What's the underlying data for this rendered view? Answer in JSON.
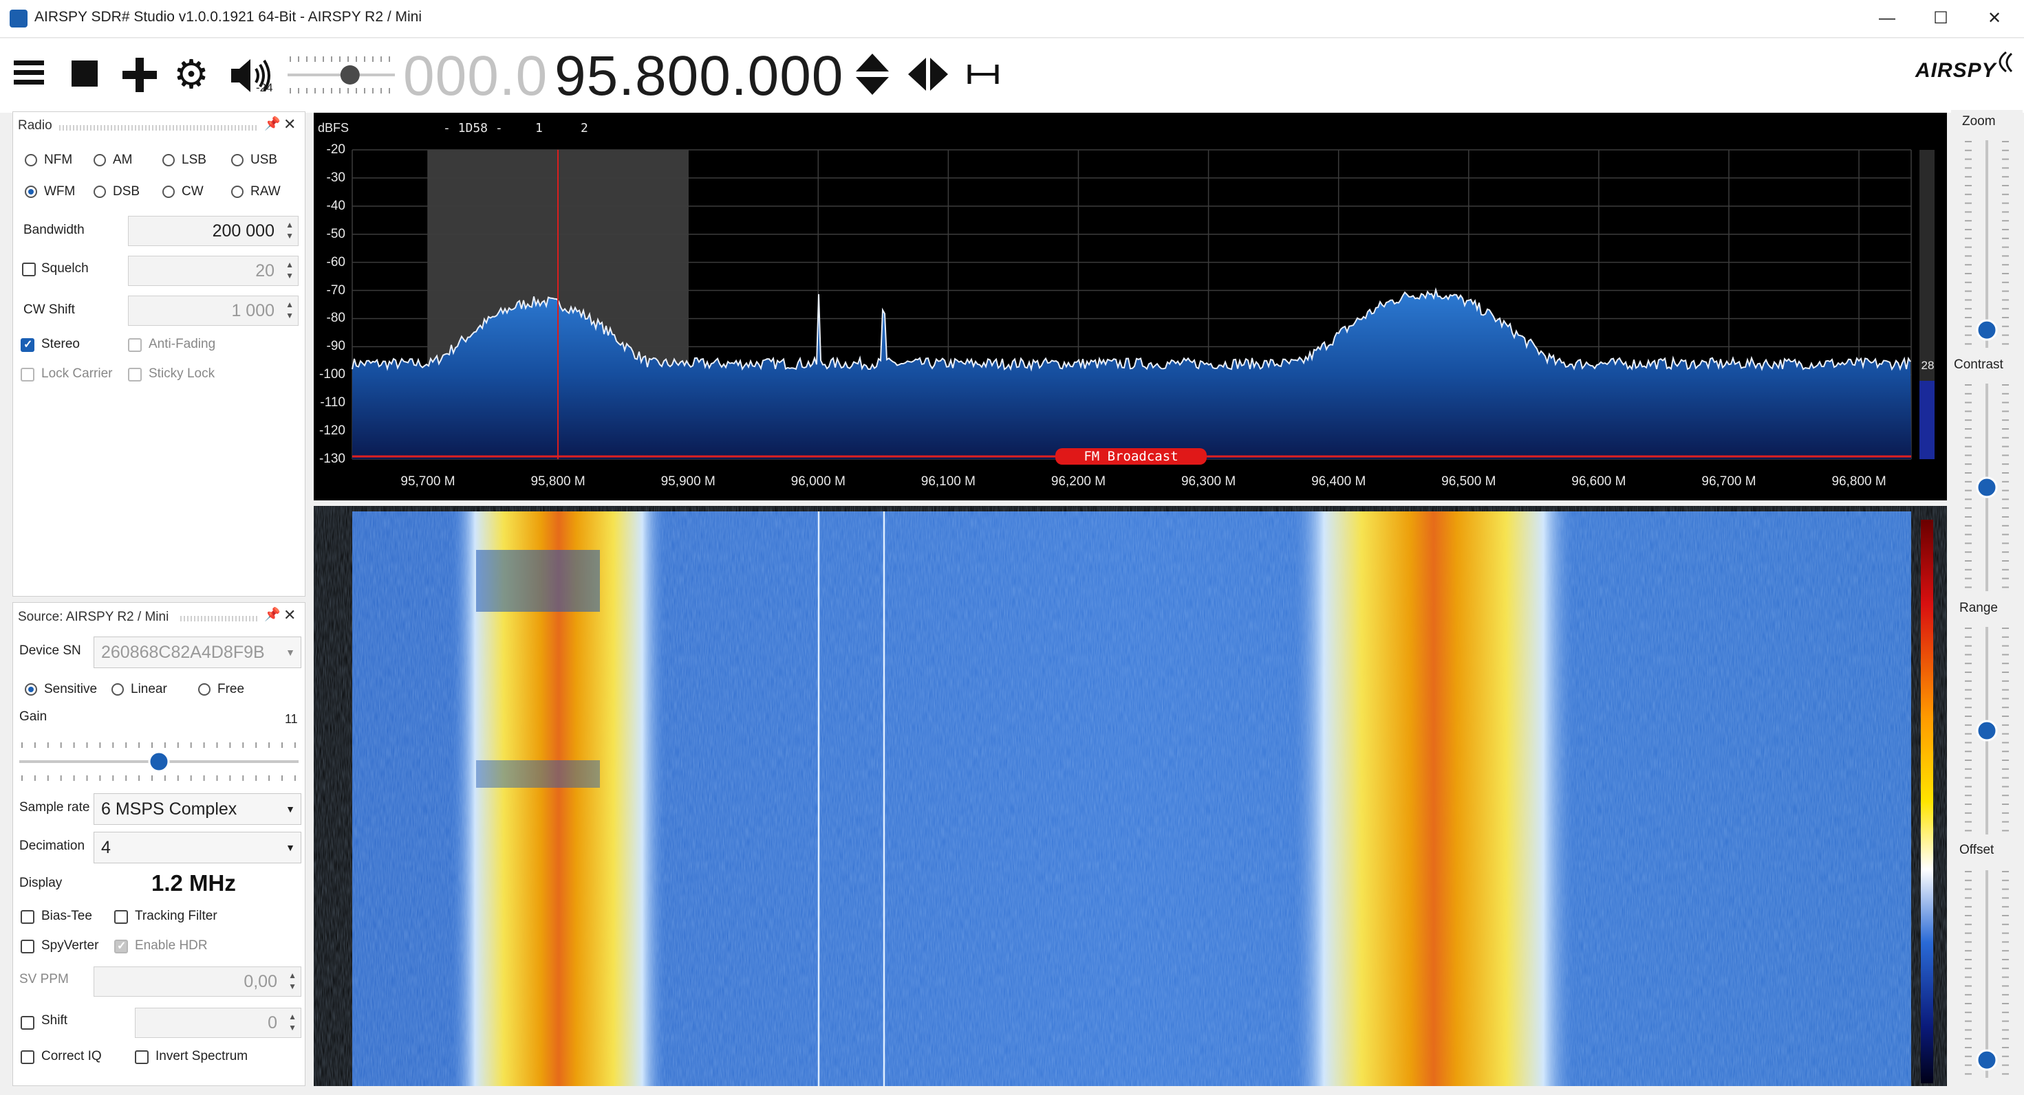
{
  "window": {
    "title": "AIRSPY SDR# Studio v1.0.0.1921 64-Bit - AIRSPY R2 / Mini",
    "controls": {
      "minimize": "—",
      "maximize": "☐",
      "close": "✕"
    }
  },
  "toolbar": {
    "menu_icon": "hamburger-icon",
    "stop_icon": "stop-icon",
    "add_icon": "plus-icon",
    "settings_icon": "gear-icon",
    "volume_icon": "speaker-icon",
    "volume_value": "-24",
    "volume_level": 0.6,
    "frequency_dim": "000.0",
    "frequency_main": "95.800.000",
    "logo": "AIRSPY"
  },
  "radio_panel": {
    "title": "Radio",
    "modes": [
      {
        "label": "NFM",
        "selected": false
      },
      {
        "label": "AM",
        "selected": false
      },
      {
        "label": "LSB",
        "selected": false
      },
      {
        "label": "USB",
        "selected": false
      },
      {
        "label": "WFM",
        "selected": true
      },
      {
        "label": "DSB",
        "selected": false
      },
      {
        "label": "CW",
        "selected": false
      },
      {
        "label": "RAW",
        "selected": false
      }
    ],
    "bandwidth_label": "Bandwidth",
    "bandwidth_value": "200 000",
    "squelch_label": "Squelch",
    "squelch_value": "20",
    "cwshift_label": "CW Shift",
    "cwshift_value": "1 000",
    "stereo_label": "Stereo",
    "antifading_label": "Anti-Fading",
    "lockcarrier_label": "Lock Carrier",
    "stickylock_label": "Sticky Lock"
  },
  "source_panel": {
    "title": "Source: AIRSPY R2 / Mini",
    "device_sn_label": "Device SN",
    "device_sn_value": "260868C82A4D8F9B",
    "gain_modes": [
      {
        "label": "Sensitive",
        "selected": true
      },
      {
        "label": "Linear",
        "selected": false
      },
      {
        "label": "Free",
        "selected": false
      }
    ],
    "gain_label": "Gain",
    "gain_value": "11",
    "gain_level": 0.5,
    "sample_rate_label": "Sample rate",
    "sample_rate_value": "6 MSPS Complex",
    "decimation_label": "Decimation",
    "decimation_value": "4",
    "display_label": "Display",
    "display_value": "1.2 MHz",
    "biastee_label": "Bias-Tee",
    "tracking_label": "Tracking Filter",
    "spyverter_label": "SpyVerter",
    "hdr_label": "Enable HDR",
    "svppm_label": "SV PPM",
    "svppm_value": "0,00",
    "shift_label": "Shift",
    "shift_value": "0",
    "correctiq_label": "Correct IQ",
    "invert_label": "Invert Spectrum"
  },
  "spectrum": {
    "unit_label": "dBFS",
    "header_markers": [
      "- 1D58 -",
      "1",
      "2"
    ],
    "y_ticks": [
      "-20",
      "-30",
      "-40",
      "-50",
      "-60",
      "-70",
      "-80",
      "-90",
      "-100",
      "-110",
      "-120",
      "-130"
    ],
    "x_ticks": [
      "95,700 M",
      "95,800 M",
      "95,900 M",
      "96,000 M",
      "96,100 M",
      "96,200 M",
      "96,300 M",
      "96,400 M",
      "96,500 M",
      "96,600 M",
      "96,700 M",
      "96,800 M"
    ],
    "band_label": "FM Broadcast",
    "level_value": "28"
  },
  "right_controls": {
    "zoom_label": "Zoom",
    "contrast_label": "Contrast",
    "range_label": "Range",
    "offset_label": "Offset",
    "zoom_level": 0.05,
    "contrast_level": 0.5,
    "range_level": 0.5,
    "offset_level": 0.05
  },
  "colors": {
    "accent": "#1a5fb4",
    "spectrum_fill": "#1f64b8",
    "band_marker": "#e02020",
    "waterfall_bg": "#2d6fd0"
  }
}
